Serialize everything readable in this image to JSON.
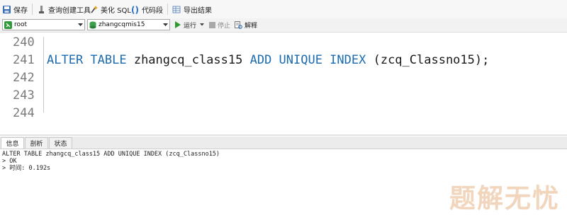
{
  "toolbar": {
    "save_label": "保存",
    "query_builder_label": "查询创建工具",
    "beautify_sql_label": "美化 SQL",
    "code_snippet_label": "代码段",
    "export_results_label": "导出结果"
  },
  "connection_bar": {
    "connection_value": "root",
    "database_value": "zhangcqmis15",
    "run_label": "运行",
    "stop_label": "停止",
    "explain_label": "解释"
  },
  "editor": {
    "lines": [
      {
        "number": "240",
        "keyword_1": "",
        "text_1": "",
        "keyword_2": "",
        "text_2": ""
      },
      {
        "number": "241",
        "keyword_1": "ALTER TABLE",
        "text_1": " zhangcq_class15 ",
        "keyword_2": "ADD UNIQUE INDEX",
        "text_2": " (zcq_Classno15);"
      },
      {
        "number": "242",
        "keyword_1": "",
        "text_1": "",
        "keyword_2": "",
        "text_2": ""
      },
      {
        "number": "243",
        "keyword_1": "",
        "text_1": "",
        "keyword_2": "",
        "text_2": ""
      },
      {
        "number": "244",
        "keyword_1": "",
        "text_1": "",
        "keyword_2": "",
        "text_2": ""
      }
    ]
  },
  "result_tabs": [
    "信息",
    "剖析",
    "状态"
  ],
  "output_lines": [
    "ALTER TABLE zhangcq_class15 ADD UNIQUE INDEX (zcq_Classno15)",
    "> OK",
    "> 时间: 0.192s"
  ],
  "watermark_text": "题解无忧",
  "colors": {
    "keyword": "#1b6bb0",
    "line_number": "#7a7a7a",
    "run_green": "#2e9b2e",
    "watermark": "#f1d6bd"
  }
}
